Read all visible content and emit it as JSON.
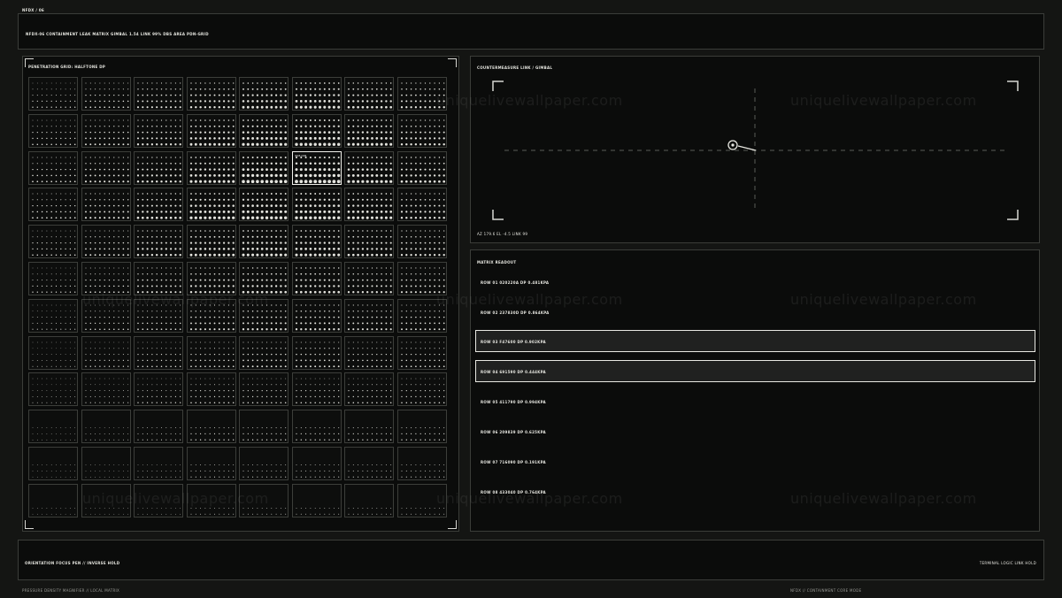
{
  "top_id": "NFDX / 06",
  "header": {
    "title": "NFDX-06   CONTAINMENT LEAK MATRIX     GIMBAL 1.54   LINK 99%   DBS AREA PDN-GRID"
  },
  "grid_panel": {
    "label": "PENETRATION GRID: HALFTONE dP",
    "rows": 12,
    "cols": 8,
    "selected_cell": {
      "row": 2,
      "col": 5,
      "tag": "R03·C06"
    },
    "dot_levels": [
      [
        0.35,
        0.45,
        0.55,
        0.65,
        0.75,
        0.8,
        0.7,
        0.6
      ],
      [
        0.4,
        0.5,
        0.6,
        0.75,
        0.85,
        0.9,
        0.8,
        0.65
      ],
      [
        0.45,
        0.55,
        0.65,
        0.8,
        0.95,
        1.0,
        0.85,
        0.7
      ],
      [
        0.45,
        0.55,
        0.7,
        0.85,
        0.9,
        0.9,
        0.8,
        0.65
      ],
      [
        0.4,
        0.5,
        0.65,
        0.75,
        0.8,
        0.8,
        0.7,
        0.6
      ],
      [
        0.35,
        0.45,
        0.55,
        0.65,
        0.7,
        0.7,
        0.6,
        0.55
      ],
      [
        0.3,
        0.4,
        0.45,
        0.55,
        0.6,
        0.6,
        0.55,
        0.5
      ],
      [
        0.25,
        0.35,
        0.4,
        0.45,
        0.5,
        0.5,
        0.45,
        0.45
      ],
      [
        0.25,
        0.3,
        0.35,
        0.4,
        0.4,
        0.4,
        0.4,
        0.4
      ],
      [
        0.2,
        0.25,
        0.3,
        0.35,
        0.35,
        0.35,
        0.35,
        0.35
      ],
      [
        0.15,
        0.2,
        0.25,
        0.3,
        0.3,
        0.3,
        0.3,
        0.3
      ],
      [
        0.1,
        0.15,
        0.2,
        0.25,
        0.25,
        0.25,
        0.25,
        0.25
      ]
    ],
    "dot_rows_visible": [
      5,
      5,
      5,
      5,
      5,
      5,
      5,
      5,
      5,
      3,
      3,
      2
    ]
  },
  "gimbal_panel": {
    "label": "COUNTERMEASURE   LINK / GIMBAL",
    "footer": "AZ 179.6   EL -4.5   LINK 99"
  },
  "readout_panel": {
    "label": "MATRIX READOUT",
    "rows": [
      {
        "text": "ROW 01  020220a  dP  0.481kPa",
        "highlighted": false
      },
      {
        "text": "ROW 02  237830d  dP  0.864kPa",
        "highlighted": false
      },
      {
        "text": "ROW 03  F47600  dP  0.902kPa",
        "highlighted": true
      },
      {
        "text": "ROW 04  691590  dP  0.444kPa",
        "highlighted": true
      },
      {
        "text": "ROW 05  411790  dP  0.994kPa",
        "highlighted": false
      },
      {
        "text": "ROW 06  209839  dP  0.625kPa",
        "highlighted": false
      },
      {
        "text": "ROW 07  716090  dP  0.191kPa",
        "highlighted": false
      },
      {
        "text": "ROW 08  433040  dP  0.764kPa",
        "highlighted": false
      }
    ]
  },
  "footer": {
    "left": "ORIENTATION  FOCUS PEN  //  INVERSE HOLD",
    "right": "TERMINAL LOGIC LINK HOLD"
  },
  "bottom_left": "PRESSURE DENSITY MAGNIFIER  //  LOCAL MATRIX",
  "bottom_right": "NFDX // CONTAINMENT CORE MODE",
  "watermark": "uniquelivewallpaper.com",
  "colors": {
    "background": "#141513",
    "panel": "#0b0c0b",
    "border": "#3b3d39",
    "accent": "#f0f0ea"
  }
}
